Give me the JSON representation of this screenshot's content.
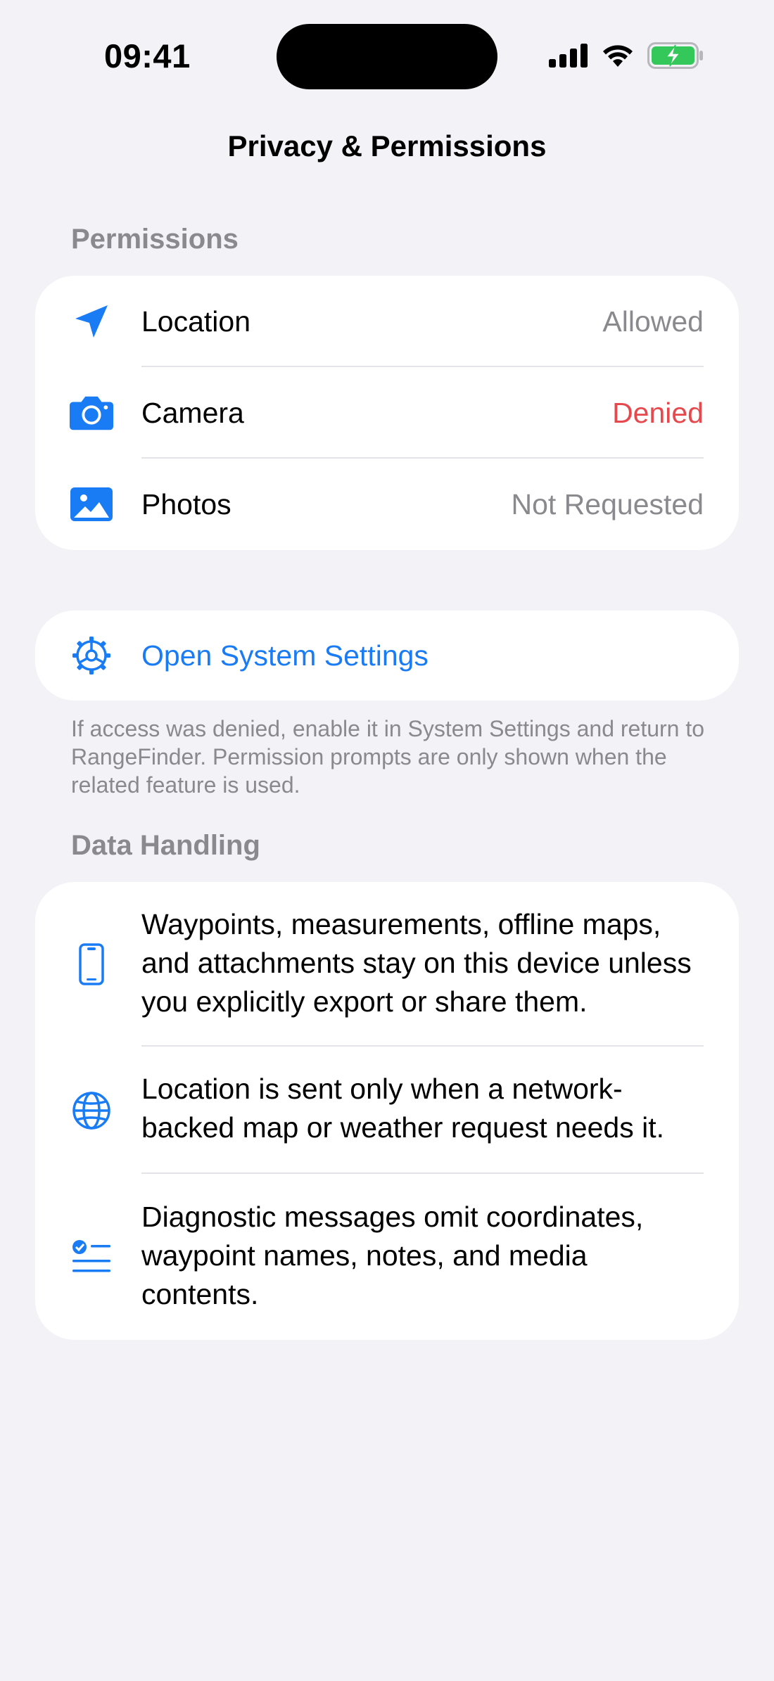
{
  "status_bar": {
    "time": "09:41"
  },
  "nav": {
    "title": "Privacy & Permissions"
  },
  "permissions": {
    "header": "Permissions",
    "items": [
      {
        "label": "Location",
        "value": "Allowed",
        "icon": "location-arrow-icon"
      },
      {
        "label": "Camera",
        "value": "Denied",
        "icon": "camera-icon"
      },
      {
        "label": "Photos",
        "value": "Not Requested",
        "icon": "photo-icon"
      }
    ]
  },
  "system_settings": {
    "label": "Open System Settings",
    "icon": "gear-icon"
  },
  "footnote": "If access was denied, enable it in System Settings and return to RangeFinder. Permission prompts are only shown when the related feature is used.",
  "data_handling": {
    "header": "Data Handling",
    "items": [
      {
        "text": "Waypoints, measurements, offline maps, and attachments stay on this device unless you explicitly export or share them.",
        "icon": "iphone-icon"
      },
      {
        "text": "Location is sent only when a network-backed map or weather request needs it.",
        "icon": "globe-icon"
      },
      {
        "text": "Diagnostic messages omit coordinates, waypoint names, notes, and media contents.",
        "icon": "checklist-icon"
      }
    ]
  },
  "colors": {
    "background": "#F2F2F7",
    "accent": "#1A7CF5",
    "denied": "#E5484D",
    "secondary_text": "#8A8A8E",
    "battery": "#34C759"
  }
}
